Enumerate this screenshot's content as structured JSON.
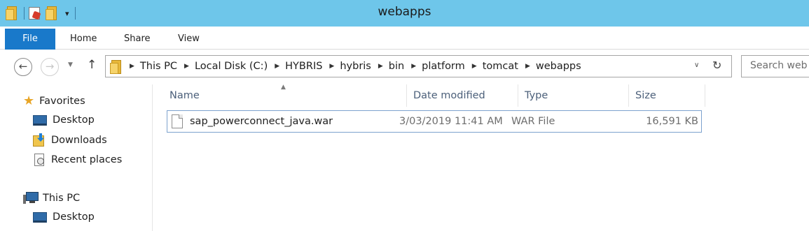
{
  "window": {
    "title": "webapps"
  },
  "quick_access_toolbar": {
    "icons": [
      "folder-icon",
      "properties-icon",
      "new-folder-icon",
      "customize-dropdown-icon"
    ]
  },
  "ribbon": {
    "tabs": [
      {
        "label": "File"
      },
      {
        "label": "Home"
      },
      {
        "label": "Share"
      },
      {
        "label": "View"
      }
    ],
    "accent_color": "#1979ca"
  },
  "navigation": {
    "back_icon": "arrow-left-icon",
    "forward_icon": "arrow-right-icon",
    "up_icon": "arrow-up-icon"
  },
  "address_bar": {
    "breadcrumbs": [
      "This PC",
      "Local Disk (C:)",
      "HYBRIS",
      "hybris",
      "bin",
      "platform",
      "tomcat",
      "webapps"
    ]
  },
  "search": {
    "placeholder": "Search web"
  },
  "nav_pane": {
    "favorites": {
      "label": "Favorites",
      "items": [
        {
          "label": "Desktop",
          "icon": "desktop-icon"
        },
        {
          "label": "Downloads",
          "icon": "downloads-icon"
        },
        {
          "label": "Recent places",
          "icon": "recent-places-icon"
        }
      ]
    },
    "this_pc": {
      "label": "This PC",
      "items": [
        {
          "label": "Desktop",
          "icon": "desktop-icon"
        }
      ]
    }
  },
  "file_list": {
    "columns": [
      "Name",
      "Date modified",
      "Type",
      "Size"
    ],
    "sort_column": "Name",
    "files": [
      {
        "name": "sap_powerconnect_java.war",
        "date_modified": "3/03/2019 11:41 AM",
        "type": "WAR File",
        "size": "16,591 KB"
      }
    ]
  },
  "colors": {
    "titlebar": "#6ec6ea",
    "file_tab": "#1979ca",
    "selection_border": "#7da2ce",
    "column_header_text": "#4c607a"
  }
}
